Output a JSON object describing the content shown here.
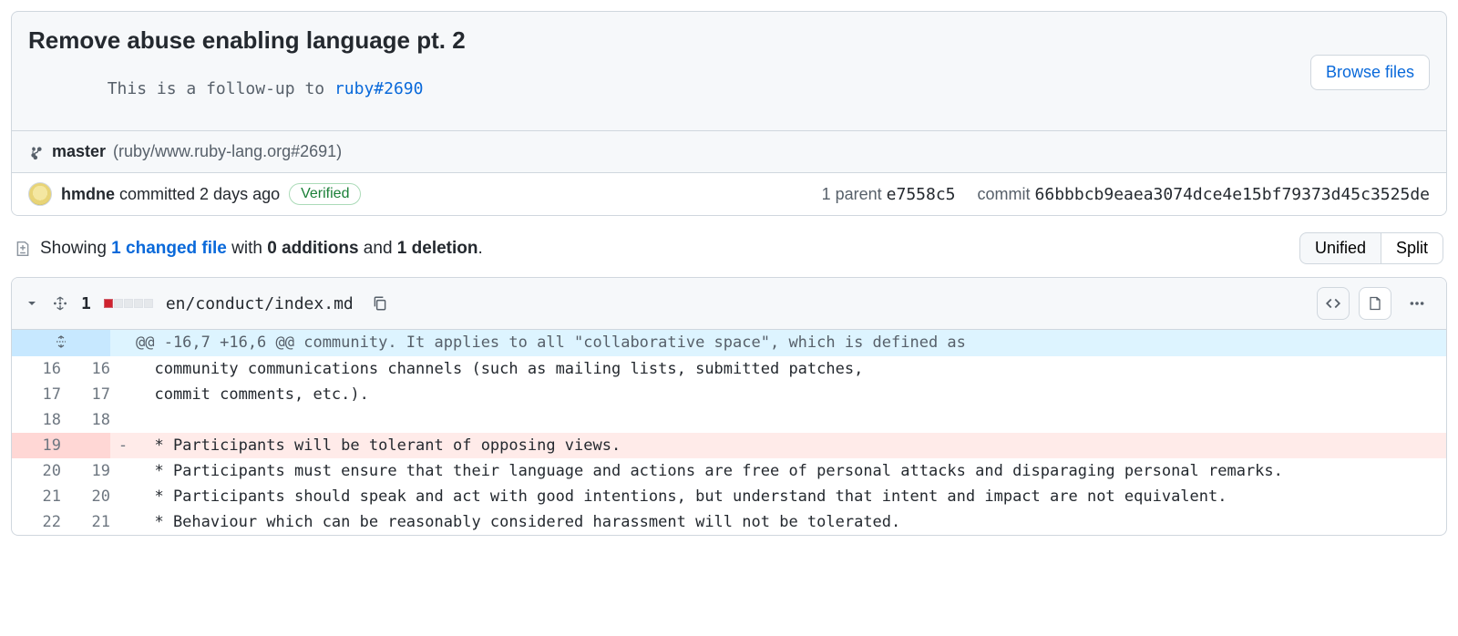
{
  "commit": {
    "title": "Remove abuse enabling language pt. 2",
    "desc_prefix": "This is a follow-up to ",
    "desc_link": "ruby#2690",
    "browse_files": "Browse files",
    "branch": "master",
    "branch_ref": "(ruby/www.ruby-lang.org#2691)",
    "author": "hmdne",
    "committed": " committed 2 days ago",
    "verified": "Verified",
    "parent_label": "1 parent ",
    "parent_sha": "e7558c5",
    "commit_label": "commit ",
    "commit_sha": "66bbbcb9eaea3074dce4e15bf79373d45c3525de"
  },
  "summary": {
    "showing": "Showing ",
    "changed": "1 changed file",
    "with": " with ",
    "additions": "0 additions",
    "and": " and ",
    "deletions": "1 deletion",
    "period": ".",
    "unified": "Unified",
    "split": "Split"
  },
  "file": {
    "changes": "1",
    "path": "en/conduct/index.md"
  },
  "diff": {
    "hunk": "@@ -16,7 +16,6 @@ community. It applies to all \"collaborative space\", which is defined as",
    "l16": "  community communications channels (such as mailing lists, submitted patches,",
    "l17": "  commit comments, etc.).",
    "l18": "",
    "l19": "  * Participants will be tolerant of opposing views.",
    "l20": "  * Participants must ensure that their language and actions are free of personal attacks and disparaging personal remarks.",
    "l21": "  * Participants should speak and act with good intentions, but understand that intent and impact are not equivalent.",
    "l22": "  * Behaviour which can be reasonably considered harassment will not be tolerated."
  }
}
